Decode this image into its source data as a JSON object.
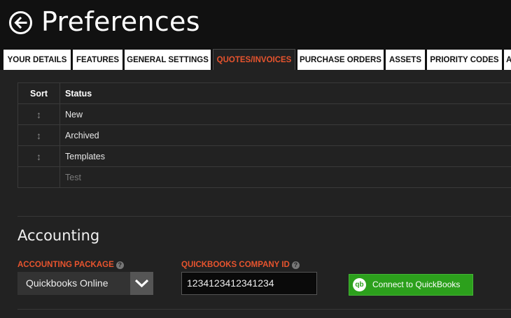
{
  "header": {
    "title": "Preferences",
    "back_icon": "arrow-left-circle-icon"
  },
  "tabs": [
    {
      "label": "YOUR DETAILS",
      "active": false
    },
    {
      "label": "FEATURES",
      "active": false
    },
    {
      "label": "GENERAL SETTINGS",
      "active": false
    },
    {
      "label": "QUOTES/INVOICES",
      "active": true
    },
    {
      "label": "PURCHASE ORDERS",
      "active": false
    },
    {
      "label": "ASSETS",
      "active": false
    },
    {
      "label": "PRIORITY CODES",
      "active": false
    },
    {
      "label": "A",
      "active": false
    }
  ],
  "status_table": {
    "headers": {
      "sort": "Sort",
      "status": "Status"
    },
    "sort_glyph": "↕",
    "rows": [
      {
        "name": "New",
        "sortable": true
      },
      {
        "name": "Archived",
        "sortable": true
      },
      {
        "name": "Templates",
        "sortable": true
      },
      {
        "name": "Test",
        "sortable": false
      }
    ]
  },
  "accounting": {
    "title": "Accounting",
    "package_label": "ACCOUNTING PACKAGE",
    "package_value": "Quickbooks Online",
    "company_id_label": "QUICKBOOKS COMPANY ID",
    "company_id_value": "1234123412341234",
    "help_glyph": "?",
    "connect_button": {
      "logo": "qb",
      "label": "Connect to QuickBooks"
    }
  },
  "colors": {
    "accent": "#e8542e",
    "quickbooks_green": "#2ca01c",
    "header_bg": "#111111",
    "content_bg": "#222222"
  }
}
